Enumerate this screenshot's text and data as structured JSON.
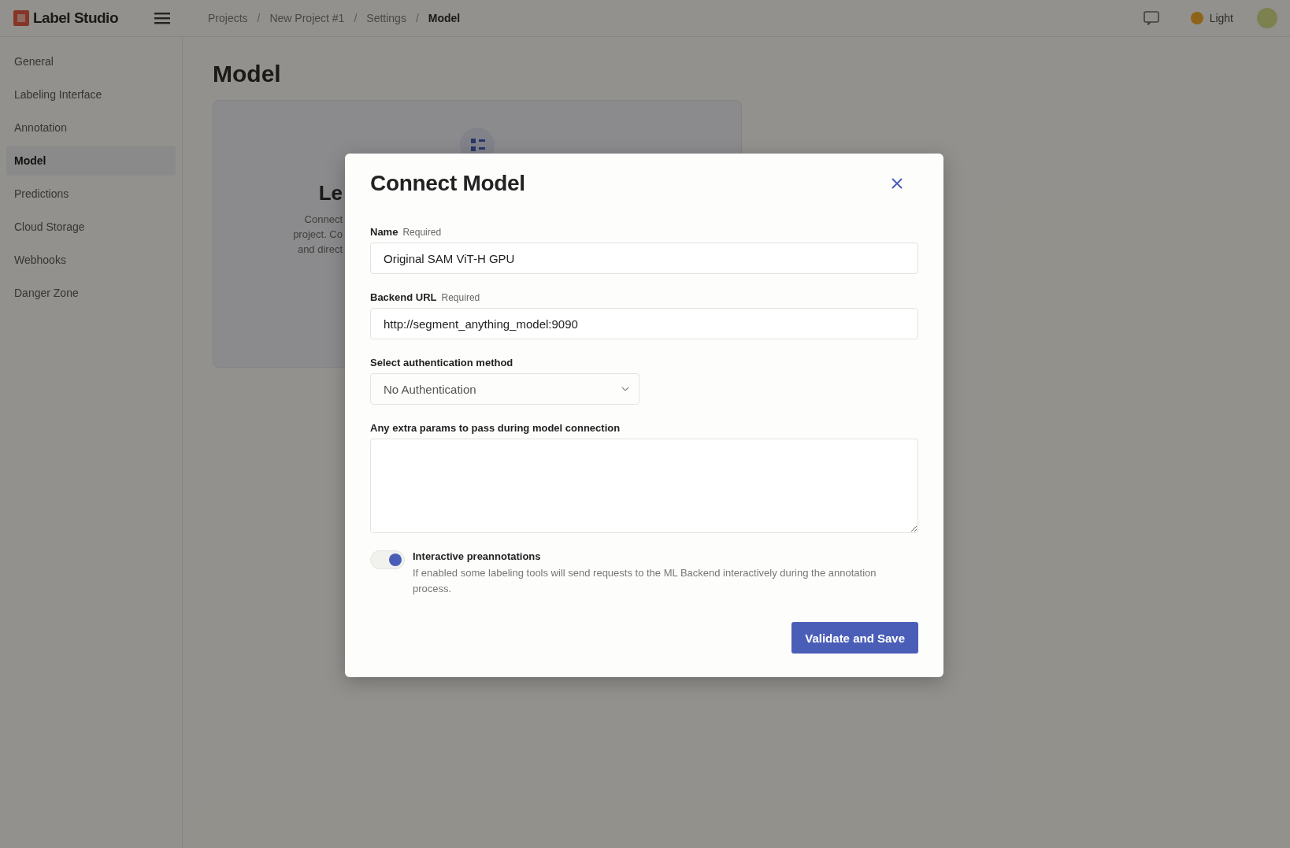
{
  "header": {
    "logo": "Label Studio",
    "breadcrumbs": [
      {
        "label": "Projects",
        "current": false
      },
      {
        "label": "New Project #1",
        "current": false
      },
      {
        "label": "Settings",
        "current": false
      },
      {
        "label": "Model",
        "current": true
      }
    ],
    "separator": "/",
    "theme": "Light"
  },
  "sidebar": {
    "items": [
      {
        "label": "General",
        "selected": false
      },
      {
        "label": "Labeling Interface",
        "selected": false
      },
      {
        "label": "Annotation",
        "selected": false
      },
      {
        "label": "Model",
        "selected": true
      },
      {
        "label": "Predictions",
        "selected": false
      },
      {
        "label": "Cloud Storage",
        "selected": false
      },
      {
        "label": "Webhooks",
        "selected": false
      },
      {
        "label": "Danger Zone",
        "selected": false
      }
    ]
  },
  "page": {
    "title": "Model",
    "card": {
      "title": "Le",
      "lines": [
        "Connect",
        "project. Co",
        "and direct"
      ]
    }
  },
  "modal": {
    "title": "Connect Model",
    "fields": [
      {
        "kind": "input",
        "label": "Name",
        "note": "Required",
        "value": "Original SAM ViT-H GPU"
      },
      {
        "kind": "input",
        "label": "Backend URL",
        "note": "Required",
        "value": "http://segment_anything_model:9090"
      },
      {
        "kind": "select",
        "label": "Select authentication method",
        "value": "No Authentication"
      },
      {
        "kind": "textarea",
        "label": "Any extra params to pass during model connection"
      }
    ],
    "toggle": {
      "label": "Interactive preannotations",
      "description": "If enabled some labeling tools will send requests to the ML Backend interactively during the annotation process.",
      "on": true
    },
    "submit": "Validate and Save"
  }
}
